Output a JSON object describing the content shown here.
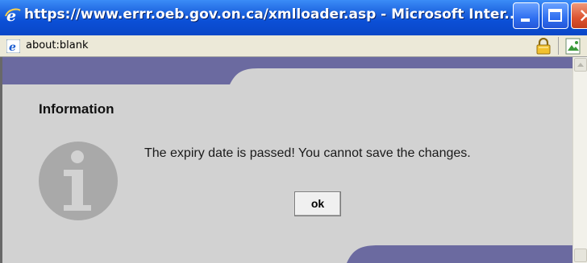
{
  "window": {
    "title": "https://www.errr.oeb.gov.on.ca/xmlloader.asp - Microsoft Inter...",
    "controls": {
      "minimize_icon": "minimize-icon",
      "maximize_icon": "maximize-icon",
      "close_icon": "close-icon",
      "close_glyph": "✕"
    },
    "colors": {
      "titlebar": "#0b4fd6",
      "close_button": "#dd5330"
    }
  },
  "address_bar": {
    "icon": "ie-page-icon",
    "url": "about:blank",
    "security_icon": "lock-icon",
    "page_icon": "image-icon"
  },
  "dialog": {
    "heading": "Information",
    "icon": "info-icon",
    "message": "The expiry date is passed! You cannot save the changes.",
    "ok_label": "ok",
    "colors": {
      "background": "#d2d2d2",
      "accent_band": "#6b6aa0",
      "icon": "#a9a9a9"
    }
  }
}
